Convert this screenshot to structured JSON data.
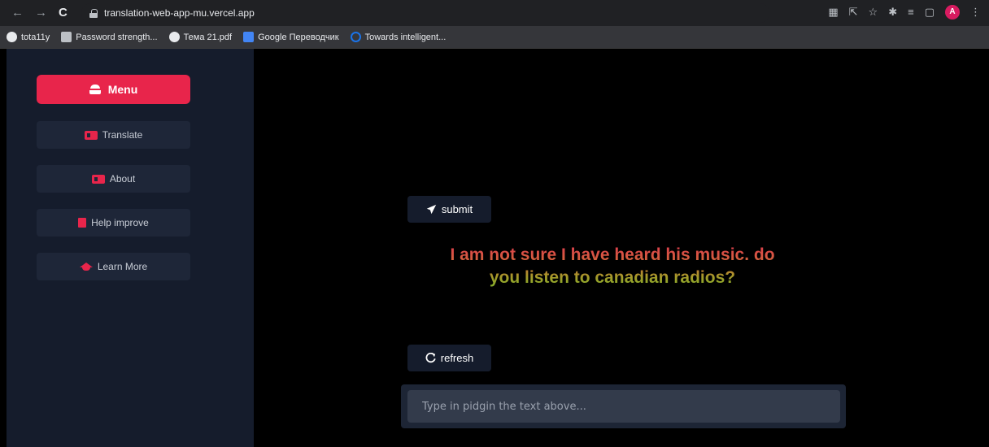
{
  "browser": {
    "nav": {
      "back": "←",
      "forward": "→",
      "reload": "C"
    },
    "url": "translation-web-app-mu.vercel.app",
    "profile_initial": "A",
    "icons": [
      "translate-icon",
      "share-icon",
      "star-icon",
      "extensions-icon",
      "reading-list-icon",
      "side-panel-icon",
      "profile-avatar",
      "more-icon"
    ]
  },
  "bookmarks": [
    {
      "label": "tota11y",
      "icon": "globe-icon"
    },
    {
      "label": "Password strength...",
      "icon": "page-icon"
    },
    {
      "label": "Тема 21.pdf",
      "icon": "globe-icon"
    },
    {
      "label": "Google Переводчик",
      "icon": "translate-icon"
    },
    {
      "label": "Towards intelligent...",
      "icon": "ring-icon"
    }
  ],
  "sidebar": {
    "menu_label": "Menu",
    "items": [
      {
        "label": "Translate",
        "icon": "translate-card-icon"
      },
      {
        "label": "About",
        "icon": "id-card-icon"
      },
      {
        "label": "Help improve",
        "icon": "book-icon"
      },
      {
        "label": "Learn More",
        "icon": "graduation-cap-icon"
      }
    ]
  },
  "main": {
    "submit_label": "submit",
    "refresh_label": "refresh",
    "sentence": "I am not sure I have heard his music. do you listen to canadian radios?",
    "input_placeholder": "Type in pidgin the text above...",
    "input_value": ""
  },
  "colors": {
    "accent": "#e8254b",
    "sidebar_bg": "#151c2c",
    "main_bg": "#000000",
    "text_gradient_top": "#e03a4e",
    "text_gradient_bottom": "#7ab12b"
  }
}
